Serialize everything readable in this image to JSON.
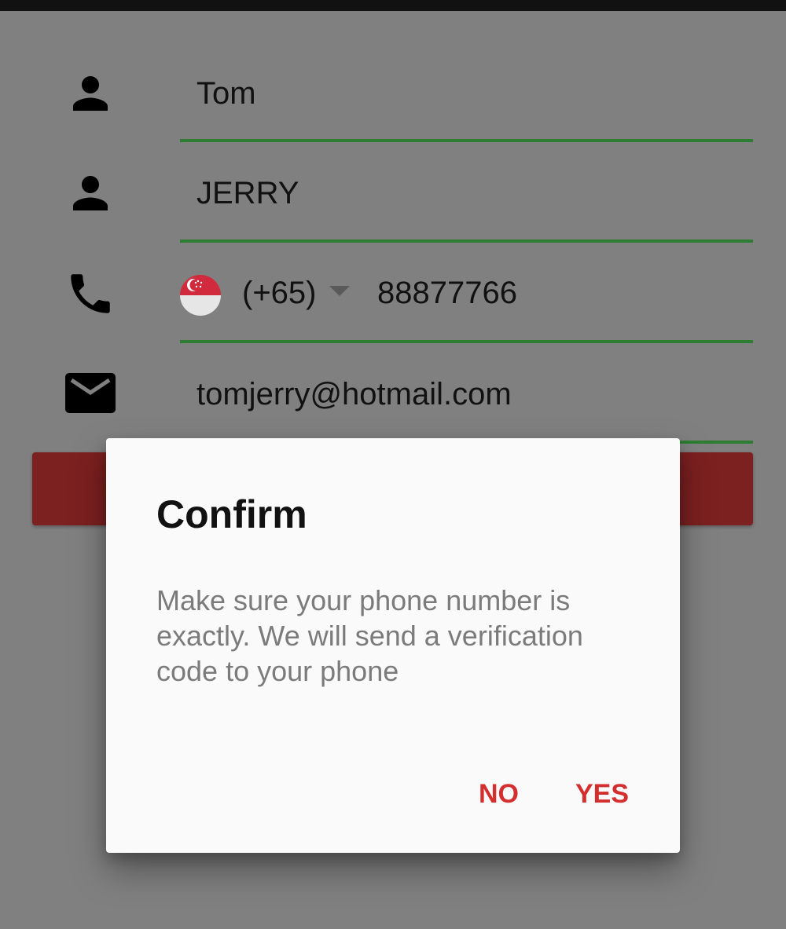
{
  "form": {
    "first_name": {
      "icon": "person-icon",
      "value": "Tom"
    },
    "last_name": {
      "icon": "person-icon",
      "value": "JERRY"
    },
    "phone": {
      "icon": "phone-icon",
      "country_flag": "singapore-flag-icon",
      "dial_code": "(+65)",
      "dropdown_icon": "caret-down-icon",
      "value": "88877766"
    },
    "email": {
      "icon": "email-icon",
      "value": "tomjerry@hotmail.com"
    },
    "underline_color": "#2e7d32"
  },
  "submit_button": {
    "color": "#b71c1c"
  },
  "dialog": {
    "title": "Confirm",
    "message": "Make sure your phone number is exactly. We will send a verification code to your phone",
    "actions": {
      "no": "NO",
      "yes": "YES"
    },
    "action_color": "#d32f2f"
  }
}
